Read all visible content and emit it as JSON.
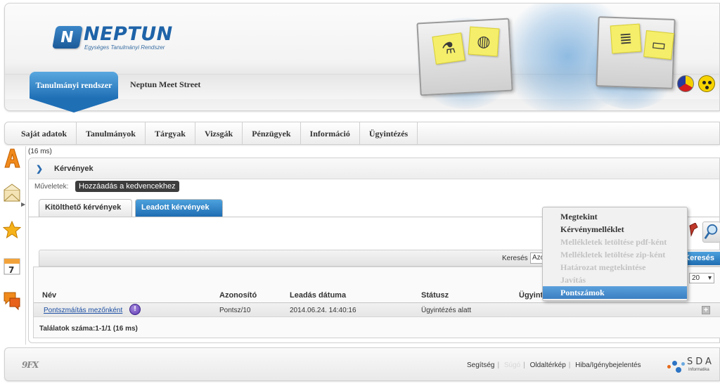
{
  "header": {
    "brand": "NEPTUN",
    "brand_tagline": "Egységes Tanulmányi Rendszer",
    "brand_letter": "N",
    "tabs": [
      {
        "label": "Tanulmányi rendszer"
      },
      {
        "label": "Neptun Meet Street"
      }
    ]
  },
  "menu": {
    "items": [
      "Saját adatok",
      "Tanulmányok",
      "Tárgyak",
      "Vizsgák",
      "Pénzügyek",
      "Információ",
      "Ügyintézés"
    ]
  },
  "main": {
    "timing": "(16 ms)",
    "panel_title": "Kérvények",
    "operations_label": "Műveletek:",
    "favorite_button": "Hozzáadás a kedvencekhez",
    "tabs": [
      "Kitölthető kérvények",
      "Leadott kérvények"
    ],
    "search": {
      "label": "Keresés",
      "field_value": "Azo",
      "button": "Keresés"
    },
    "pager_value": "20",
    "table": {
      "headers": [
        "Név",
        "Azonosító",
        "Leadás dátuma",
        "Státusz",
        "Ügyint"
      ],
      "rows": [
        {
          "name": "Pontszmáítás mezőnként",
          "id": "Pontsz/10",
          "date": "2014.06.24. 14:40:16",
          "status": "Ügyintézés alatt"
        }
      ]
    },
    "results": "Találatok száma:1-1/1 (16 ms)"
  },
  "context_menu": {
    "items": [
      {
        "label": "Megtekint",
        "state": "enabled"
      },
      {
        "label": "Kérvénymelléklet",
        "state": "enabled"
      },
      {
        "label": "Mellékletek letöltése pdf-ként",
        "state": "disabled"
      },
      {
        "label": "Mellékletek letöltése zip-ként",
        "state": "disabled"
      },
      {
        "label": "Határozat megtekintése",
        "state": "disabled"
      },
      {
        "label": "Javítás",
        "state": "disabled"
      },
      {
        "label": "Pontszámok",
        "state": "active"
      }
    ]
  },
  "footer": {
    "logo": "9FX",
    "links": [
      "Segítség",
      "Súgó",
      "Oldaltérkép",
      "Hiba/Igénybejelentés"
    ],
    "partner": "SDA",
    "partner_sub": "Informatika"
  },
  "icons": {
    "sidebar": [
      "letter-a-icon",
      "envelope-icon",
      "star-icon",
      "calendar-icon",
      "chat-icon"
    ],
    "accent": "#1f6fb5",
    "brand_color": "#1e63a8"
  }
}
